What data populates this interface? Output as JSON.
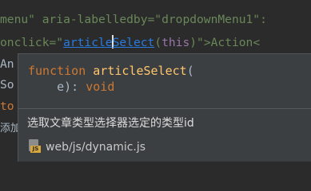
{
  "editor": {
    "line1": {
      "text1": "menu\" aria-labelledby=\"dropdownMenu1\":"
    },
    "line2": {
      "prefix": "onclick=\"",
      "fn_before_caret": "article",
      "fn_after_caret": "Select",
      "args": "(",
      "param": "this",
      "suffix": ")\">Action<"
    },
    "line3": {
      "text": "An"
    },
    "line4": {
      "text": "So"
    },
    "line5": {
      "text": "to"
    },
    "line6": {
      "text": "添加"
    }
  },
  "popup": {
    "signature": {
      "keyword": "function",
      "name": "articleSelect",
      "open": "(",
      "param_line": "    e): ",
      "return_type": "void"
    },
    "description": "选取文章类型选择器选定的类型id",
    "file": {
      "icon": "js-file-icon",
      "path": "web/js/dynamic.js"
    }
  }
}
